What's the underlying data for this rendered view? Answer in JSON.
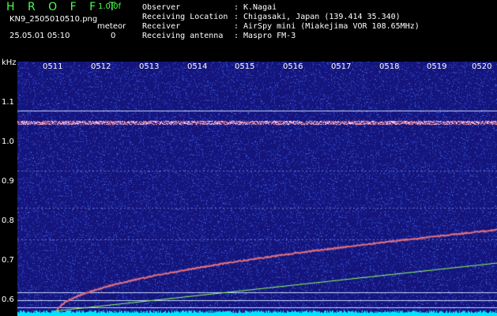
{
  "header": {
    "app_title": "H R O F F T",
    "version": "1.0.0f",
    "filename": "KN9_2505010510.png",
    "meteor_label": "meteor",
    "meteor_count": "0",
    "datetime": "25.05.01 05:10"
  },
  "info": [
    {
      "key": "Observer",
      "value": "K.Nagai"
    },
    {
      "key": "Receiving Location",
      "value": "Chigasaki, Japan (139.414 35.340)"
    },
    {
      "key": "Receiver",
      "value": "AirSpy mini (Miakejima VOR 108.65MHz)"
    },
    {
      "key": "Receiving antenna",
      "value": "Maspro FM-3"
    }
  ],
  "separator": ":",
  "axis": {
    "unit": "kHz",
    "y_ticks": [
      "1.1",
      "1.0",
      "0.9",
      "0.8",
      "0.7",
      "0.6"
    ],
    "x_ticks": [
      "0511",
      "0512",
      "0513",
      "0514",
      "0515",
      "0516",
      "0517",
      "0518",
      "0519",
      "0520"
    ]
  },
  "colors": {
    "background": "#000000",
    "spectrogram_bg": "#14147a",
    "noise_floor": "#00e5ff",
    "carrier": "#ff8080",
    "header_accent": "#4cff4c",
    "ref_line": "#c8d8ff",
    "trace_green": "#90ff60"
  }
}
